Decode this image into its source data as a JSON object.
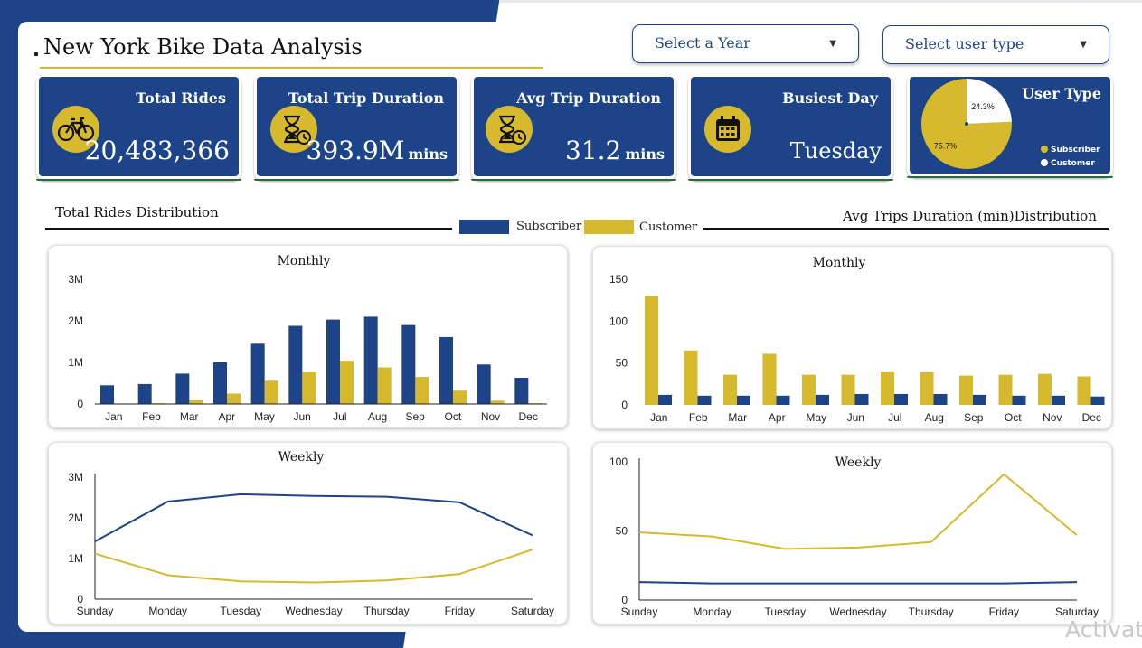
{
  "header": {
    "title": "New York Bike Data Analysis"
  },
  "filters": {
    "year": {
      "placeholder": "Select a Year"
    },
    "user_type": {
      "placeholder": "Select user type"
    }
  },
  "kpis": {
    "total_rides": {
      "label": "Total Rides",
      "value": "20,483,366",
      "icon": "bicycle-icon"
    },
    "total_trip_duration": {
      "label": "Total Trip Duration",
      "value": "393.9M",
      "unit": "mins",
      "icon": "hourglass-clock-icon"
    },
    "avg_trip_duration": {
      "label": "Avg Trip Duration",
      "value": "31.2",
      "unit": "mins",
      "icon": "hourglass-clock-icon"
    },
    "busiest_day": {
      "label": "Busiest Day",
      "value": "Tuesday",
      "icon": "calendar-icon"
    }
  },
  "sections": {
    "rides_title": "Total Rides Distribution",
    "duration_title": "Avg Trips Duration (min)Distribution"
  },
  "legend": {
    "subscriber": "Subscriber",
    "customer": "Customer"
  },
  "colors": {
    "navy": "#1d4489",
    "gold": "#d6b92c"
  },
  "watermark": "Activat",
  "chart_data": [
    {
      "id": "user_type_pie",
      "type": "pie",
      "title": "User Type",
      "labels": [
        "Subscriber",
        "Customer"
      ],
      "values": [
        75.7,
        24.3
      ],
      "value_labels": [
        "75.7%",
        "24.3%"
      ],
      "colors": [
        "#d6b92c",
        "#ffffff"
      ],
      "legend_position": "bottom-right"
    },
    {
      "id": "rides_monthly",
      "type": "bar",
      "title": "Monthly",
      "categories": [
        "Jan",
        "Feb",
        "Mar",
        "Apr",
        "May",
        "Jun",
        "Jul",
        "Aug",
        "Sep",
        "Oct",
        "Nov",
        "Dec"
      ],
      "series": [
        {
          "name": "Subscriber",
          "color": "#1d4489",
          "values": [
            450000,
            480000,
            730000,
            1000000,
            1450000,
            1880000,
            2030000,
            2100000,
            1900000,
            1610000,
            950000,
            630000
          ]
        },
        {
          "name": "Customer",
          "color": "#d6b92c",
          "values": [
            10000,
            20000,
            90000,
            250000,
            560000,
            760000,
            1040000,
            880000,
            650000,
            320000,
            80000,
            20000
          ]
        }
      ],
      "yticks": [
        0,
        1000000,
        2000000,
        3000000
      ],
      "ytick_labels": [
        "0",
        "1M",
        "2M",
        "3M"
      ],
      "ylim": [
        0,
        3000000
      ]
    },
    {
      "id": "duration_monthly",
      "type": "bar",
      "title": "Monthly",
      "categories": [
        "Jan",
        "Feb",
        "Mar",
        "Apr",
        "May",
        "Jun",
        "Jul",
        "Aug",
        "Sep",
        "Oct",
        "Nov",
        "Dec"
      ],
      "series": [
        {
          "name": "Customer",
          "color": "#d6b92c",
          "values": [
            130,
            65,
            36,
            61,
            36,
            36,
            39,
            39,
            35,
            36,
            37,
            34
          ]
        },
        {
          "name": "Subscriber",
          "color": "#1d4489",
          "values": [
            12,
            11,
            11,
            11,
            12,
            13,
            13,
            13,
            12,
            11,
            11,
            10
          ]
        }
      ],
      "yticks": [
        0,
        50,
        100,
        150
      ],
      "ytick_labels": [
        "0",
        "50",
        "100",
        "150"
      ],
      "ylim": [
        0,
        150
      ]
    },
    {
      "id": "rides_weekly",
      "type": "line",
      "title": "Weekly",
      "x": [
        "Sunday",
        "Monday",
        "Tuesday",
        "Wednesday",
        "Thursday",
        "Friday",
        "Saturday"
      ],
      "series": [
        {
          "name": "Subscriber",
          "color": "#1d4489",
          "values": [
            1420000,
            2400000,
            2580000,
            2540000,
            2520000,
            2380000,
            1570000
          ]
        },
        {
          "name": "Customer",
          "color": "#d6b92c",
          "values": [
            1120000,
            590000,
            440000,
            410000,
            460000,
            620000,
            1220000
          ]
        }
      ],
      "yticks": [
        0,
        1000000,
        2000000,
        3000000
      ],
      "ytick_labels": [
        "0",
        "1M",
        "2M",
        "3M"
      ],
      "ylim": [
        0,
        3000000
      ]
    },
    {
      "id": "duration_weekly",
      "type": "line",
      "title": "Weekly",
      "x": [
        "Sunday",
        "Monday",
        "Tuesday",
        "Wednesday",
        "Thursday",
        "Friday",
        "Saturday"
      ],
      "series": [
        {
          "name": "Customer",
          "color": "#d6b92c",
          "values": [
            49,
            46,
            37,
            38,
            42,
            91,
            47
          ]
        },
        {
          "name": "Subscriber",
          "color": "#1d4489",
          "values": [
            13,
            12,
            12,
            12,
            12,
            12,
            13
          ]
        }
      ],
      "yticks": [
        0,
        50,
        100
      ],
      "ytick_labels": [
        "0",
        "50",
        "100"
      ],
      "ylim": [
        0,
        100
      ]
    }
  ]
}
